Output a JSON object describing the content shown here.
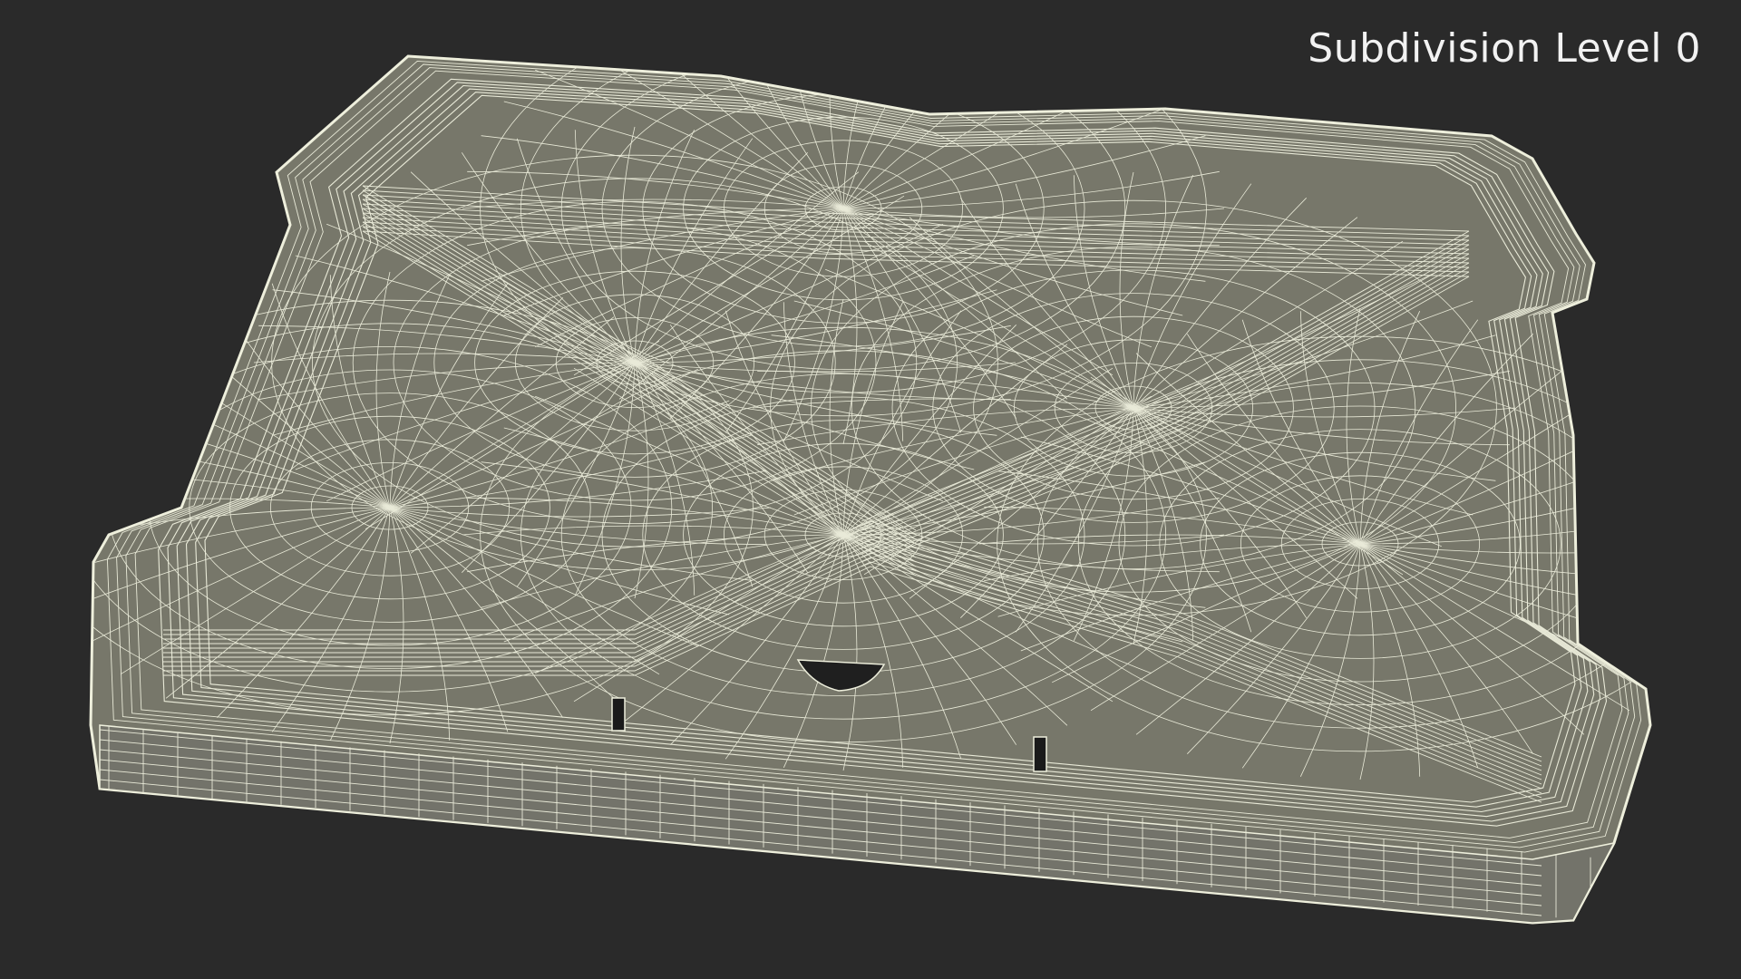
{
  "viewport": {
    "label": "Subdivision Level 0",
    "background_color": "#2a2a2a",
    "surface_color": "#77776a",
    "wire_color": "#e9ead8"
  },
  "object": {
    "icon": "wireframe-tray-model"
  }
}
